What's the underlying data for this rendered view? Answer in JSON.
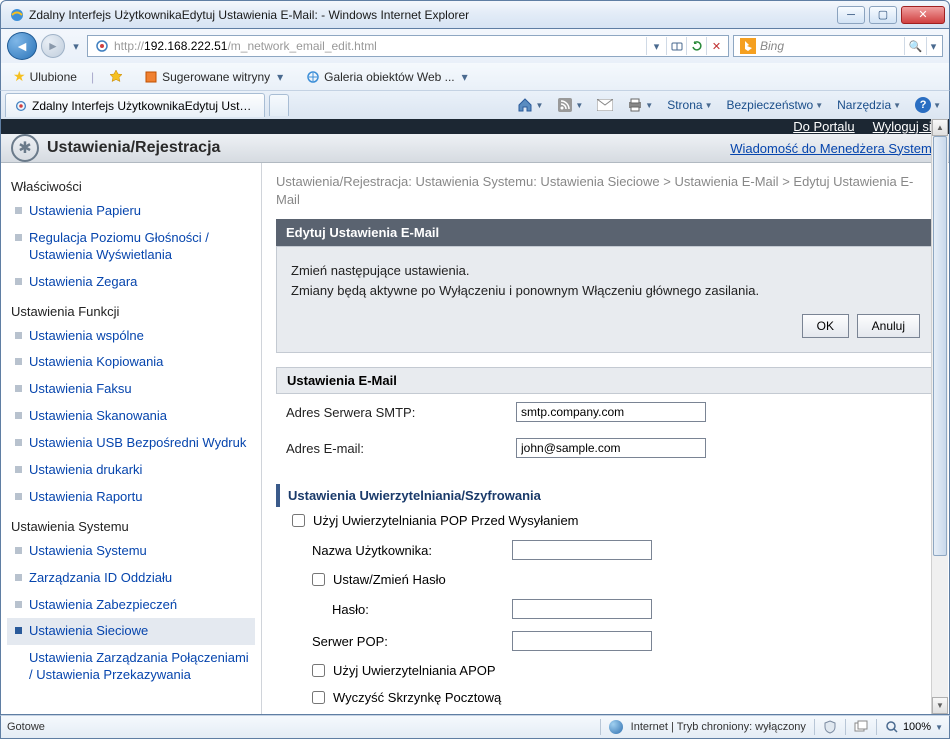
{
  "window": {
    "title": "Zdalny Interfejs UżytkownikaEdytuj Ustawienia E-Mail:                                          - Windows Internet Explorer"
  },
  "address": {
    "prefix": "http://",
    "host": "192.168.222.51",
    "path": "/m_network_email_edit.html"
  },
  "search": {
    "placeholder": "Bing"
  },
  "favbar": {
    "favorites": "Ulubione",
    "suggested": "Sugerowane witryny",
    "gallery": "Galeria obiektów Web ..."
  },
  "tab": {
    "title": "Zdalny Interfejs UżytkownikaEdytuj Ustawienia E-..."
  },
  "cmdbar": {
    "page": "Strona",
    "safety": "Bezpieczeństwo",
    "tools": "Narzędzia"
  },
  "toplinks": {
    "portal": "Do Portalu",
    "logout": "Wyloguj się"
  },
  "header": {
    "title": "Ustawienia/Rejestracja",
    "link": "Wiadomość do Menedżera Systemu"
  },
  "sidebar": {
    "g1": "Właściwości",
    "i1": "Ustawienia Papieru",
    "i2": "Regulacja Poziomu Głośności / Ustawienia Wyświetlania",
    "i3": "Ustawienia Zegara",
    "g2": "Ustawienia Funkcji",
    "i4": "Ustawienia wspólne",
    "i5": "Ustawienia Kopiowania",
    "i6": "Ustawienia Faksu",
    "i7": "Ustawienia Skanowania",
    "i8": "Ustawienia USB Bezpośredni Wydruk",
    "i9": "Ustawienia drukarki",
    "i10": "Ustawienia Raportu",
    "g3": "Ustawienia Systemu",
    "i11": "Ustawienia Systemu",
    "i12": "Zarządzania ID Oddziału",
    "i13": "Ustawienia Zabezpieczeń",
    "i14": "Ustawienia Sieciowe",
    "i15": "Ustawienia Zarządzania Połączeniami / Ustawienia Przekazywania"
  },
  "breadcrumb": {
    "t1": "Ustawienia/Rejestracja: Ustawienia Systemu: Ustawienia Sieciowe",
    "t2": "Ustawienia E-Mail",
    "t3": "Edytuj Ustawienia E-Mail"
  },
  "panel": {
    "title": "Edytuj Ustawienia E-Mail",
    "info1": "Zmień następujące ustawienia.",
    "info2": "Zmiany będą aktywne po Wyłączeniu i ponownym Włączeniu głównego zasilania.",
    "ok": "OK",
    "cancel": "Anuluj"
  },
  "emailSettings": {
    "head": "Ustawienia E-Mail",
    "smtpLabel": "Adres Serwera SMTP:",
    "smtpValue": "smtp.company.com",
    "emailLabel": "Adres E-mail:",
    "emailValue": "john@sample.com"
  },
  "authSettings": {
    "head": "Ustawienia Uwierzytelniania/Szyfrowania",
    "popBefore": "Użyj Uwierzytelniania POP Przed Wysyłaniem",
    "userLabel": "Nazwa Użytkownika:",
    "userValue": "",
    "setPass": "Ustaw/Zmień Hasło",
    "passLabel": "Hasło:",
    "passValue": "",
    "popLabel": "Serwer POP:",
    "popValue": "",
    "apop": "Użyj Uwierzytelniania APOP",
    "clearBox": "Wyczyść Skrzynkę Pocztową"
  },
  "status": {
    "ready": "Gotowe",
    "zone": "Internet | Tryb chroniony: wyłączony",
    "zoom": "100%"
  }
}
